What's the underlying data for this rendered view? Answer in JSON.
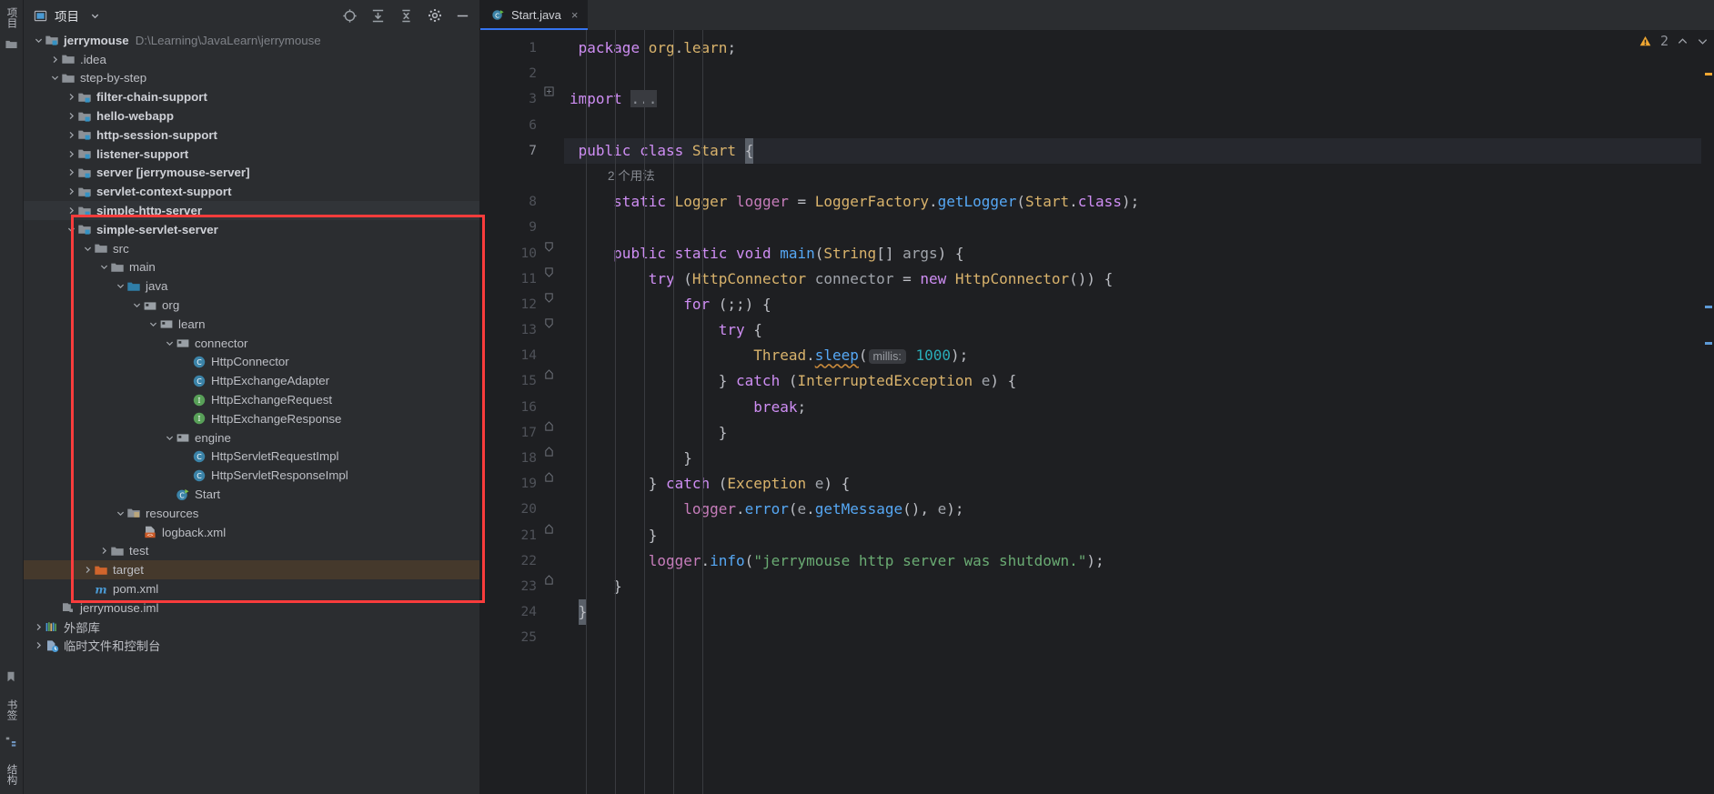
{
  "window": {
    "left_strip_top": [
      "项目"
    ],
    "left_strip_bottom": [
      "书签",
      "结构"
    ]
  },
  "project_panel": {
    "title": "项目",
    "title_icon": "project-panel-icon",
    "actions": [
      {
        "name": "select-opened-file-icon",
        "label": "定位"
      },
      {
        "name": "expand-all-icon",
        "label": "全部展开"
      },
      {
        "name": "collapse-all-icon",
        "label": "全部折叠"
      },
      {
        "name": "settings-gear-icon",
        "label": "选项"
      },
      {
        "name": "hide-panel-icon",
        "label": "隐藏"
      }
    ],
    "tree": [
      {
        "depth": 0,
        "arrow": "down",
        "icon": "module-root",
        "label": "jerrymouse",
        "bold": true,
        "hint": "D:\\Learning\\JavaLearn\\jerrymouse"
      },
      {
        "depth": 1,
        "arrow": "right",
        "icon": "folder",
        "label": ".idea"
      },
      {
        "depth": 1,
        "arrow": "down",
        "icon": "folder",
        "label": "step-by-step"
      },
      {
        "depth": 2,
        "arrow": "right",
        "icon": "module",
        "label": "filter-chain-support",
        "bold": true
      },
      {
        "depth": 2,
        "arrow": "right",
        "icon": "module",
        "label": "hello-webapp",
        "bold": true
      },
      {
        "depth": 2,
        "arrow": "right",
        "icon": "module",
        "label": "http-session-support",
        "bold": true
      },
      {
        "depth": 2,
        "arrow": "right",
        "icon": "module",
        "label": "listener-support",
        "bold": true
      },
      {
        "depth": 2,
        "arrow": "right",
        "icon": "module",
        "label": "server [jerrymouse-server]",
        "bold": true
      },
      {
        "depth": 2,
        "arrow": "right",
        "icon": "module",
        "label": "servlet-context-support",
        "bold": true
      },
      {
        "depth": 2,
        "arrow": "right",
        "icon": "module",
        "label": "simple-http-server",
        "bold": true,
        "row_state": "sel-grey"
      },
      {
        "depth": 2,
        "arrow": "down",
        "icon": "module",
        "label": "simple-servlet-server",
        "bold": true
      },
      {
        "depth": 3,
        "arrow": "down",
        "icon": "folder",
        "label": "src"
      },
      {
        "depth": 4,
        "arrow": "down",
        "icon": "folder",
        "label": "main"
      },
      {
        "depth": 5,
        "arrow": "down",
        "icon": "source-root",
        "label": "java"
      },
      {
        "depth": 6,
        "arrow": "down",
        "icon": "package",
        "label": "org"
      },
      {
        "depth": 7,
        "arrow": "down",
        "icon": "package",
        "label": "learn"
      },
      {
        "depth": 8,
        "arrow": "down",
        "icon": "package",
        "label": "connector"
      },
      {
        "depth": 9,
        "arrow": "none",
        "icon": "class",
        "label": "HttpConnector"
      },
      {
        "depth": 9,
        "arrow": "none",
        "icon": "class",
        "label": "HttpExchangeAdapter"
      },
      {
        "depth": 9,
        "arrow": "none",
        "icon": "interface",
        "label": "HttpExchangeRequest"
      },
      {
        "depth": 9,
        "arrow": "none",
        "icon": "interface",
        "label": "HttpExchangeResponse"
      },
      {
        "depth": 8,
        "arrow": "down",
        "icon": "package",
        "label": "engine"
      },
      {
        "depth": 9,
        "arrow": "none",
        "icon": "class",
        "label": "HttpServletRequestImpl"
      },
      {
        "depth": 9,
        "arrow": "none",
        "icon": "class",
        "label": "HttpServletResponseImpl"
      },
      {
        "depth": 8,
        "arrow": "none",
        "icon": "runnable-class",
        "label": "Start"
      },
      {
        "depth": 5,
        "arrow": "down",
        "icon": "resource-root",
        "label": "resources"
      },
      {
        "depth": 6,
        "arrow": "none",
        "icon": "xml-file",
        "label": "logback.xml"
      },
      {
        "depth": 4,
        "arrow": "right",
        "icon": "folder",
        "label": "test"
      },
      {
        "depth": 3,
        "arrow": "right",
        "icon": "excluded-folder",
        "label": "target",
        "row_state": "sel-brown"
      },
      {
        "depth": 3,
        "arrow": "none",
        "icon": "maven-file",
        "label": "pom.xml"
      },
      {
        "depth": 1,
        "arrow": "none",
        "icon": "iml-file",
        "label": "jerrymouse.iml"
      },
      {
        "depth": 0,
        "arrow": "right",
        "icon": "external-libraries",
        "label": "外部库"
      },
      {
        "depth": 0,
        "arrow": "right",
        "icon": "scratches",
        "label": "临时文件和控制台"
      }
    ]
  },
  "editor": {
    "tabs": [
      {
        "label": "Start.java",
        "icon": "runnable-class",
        "active": true,
        "close": "×"
      }
    ],
    "warning_icon": "warning-triangle-icon",
    "warning_count": "2",
    "nav_up": "⌃",
    "nav_down": "⌄",
    "inlay_hints": {
      "class_usages": "2 个用法",
      "sleep_param": "millis:"
    },
    "lines": [
      {
        "no": "1",
        "type": "code"
      },
      {
        "no": "2",
        "type": "code"
      },
      {
        "no": "3",
        "type": "code",
        "fold": "plus"
      },
      {
        "no": "6",
        "type": "code"
      },
      {
        "no": "7",
        "type": "code",
        "run": true,
        "current": true
      },
      {
        "no": "",
        "type": "inlay"
      },
      {
        "no": "8",
        "type": "code"
      },
      {
        "no": "9",
        "type": "code"
      },
      {
        "no": "10",
        "type": "code",
        "run": true,
        "fold": "open"
      },
      {
        "no": "11",
        "type": "code",
        "fold": "open"
      },
      {
        "no": "12",
        "type": "code",
        "fold": "open"
      },
      {
        "no": "13",
        "type": "code",
        "fold": "open"
      },
      {
        "no": "14",
        "type": "code"
      },
      {
        "no": "15",
        "type": "code",
        "fold": "close"
      },
      {
        "no": "16",
        "type": "code"
      },
      {
        "no": "17",
        "type": "code",
        "fold": "close"
      },
      {
        "no": "18",
        "type": "code",
        "fold": "close"
      },
      {
        "no": "19",
        "type": "code",
        "fold": "close"
      },
      {
        "no": "20",
        "type": "code"
      },
      {
        "no": "21",
        "type": "code",
        "fold": "close"
      },
      {
        "no": "22",
        "type": "code"
      },
      {
        "no": "23",
        "type": "code",
        "fold": "close"
      },
      {
        "no": "24",
        "type": "code"
      },
      {
        "no": "25",
        "type": "code"
      }
    ],
    "source_text": {
      "l1": "package org.learn;",
      "l3": "import ...",
      "l7": "public class Start {",
      "l8": "static Logger logger = LoggerFactory.getLogger(Start.class);",
      "l10": "public static void main(String[] args) {",
      "l11": "try (HttpConnector connector = new HttpConnector()) {",
      "l12": "for (;;) {",
      "l13": "try {",
      "l14": "Thread.sleep( millis: 1000);",
      "l15": "} catch (InterruptedException e) {",
      "l16": "break;",
      "l17": "}",
      "l18": "}",
      "l19": "} catch (Exception e) {",
      "l20": "logger.error(e.getMessage(), e);",
      "l21": "}",
      "l22": "logger.info(\"jerrymouse http server was shutdown.\");",
      "l23": "}",
      "l24": "}"
    }
  },
  "colors": {
    "accent": "#3574f0",
    "annotation_red": "#fa3c3c",
    "panel_bg": "#2b2d30",
    "editor_bg": "#1e1f22",
    "selection_brown": "#45392c",
    "warning_orange": "#f0a732"
  }
}
